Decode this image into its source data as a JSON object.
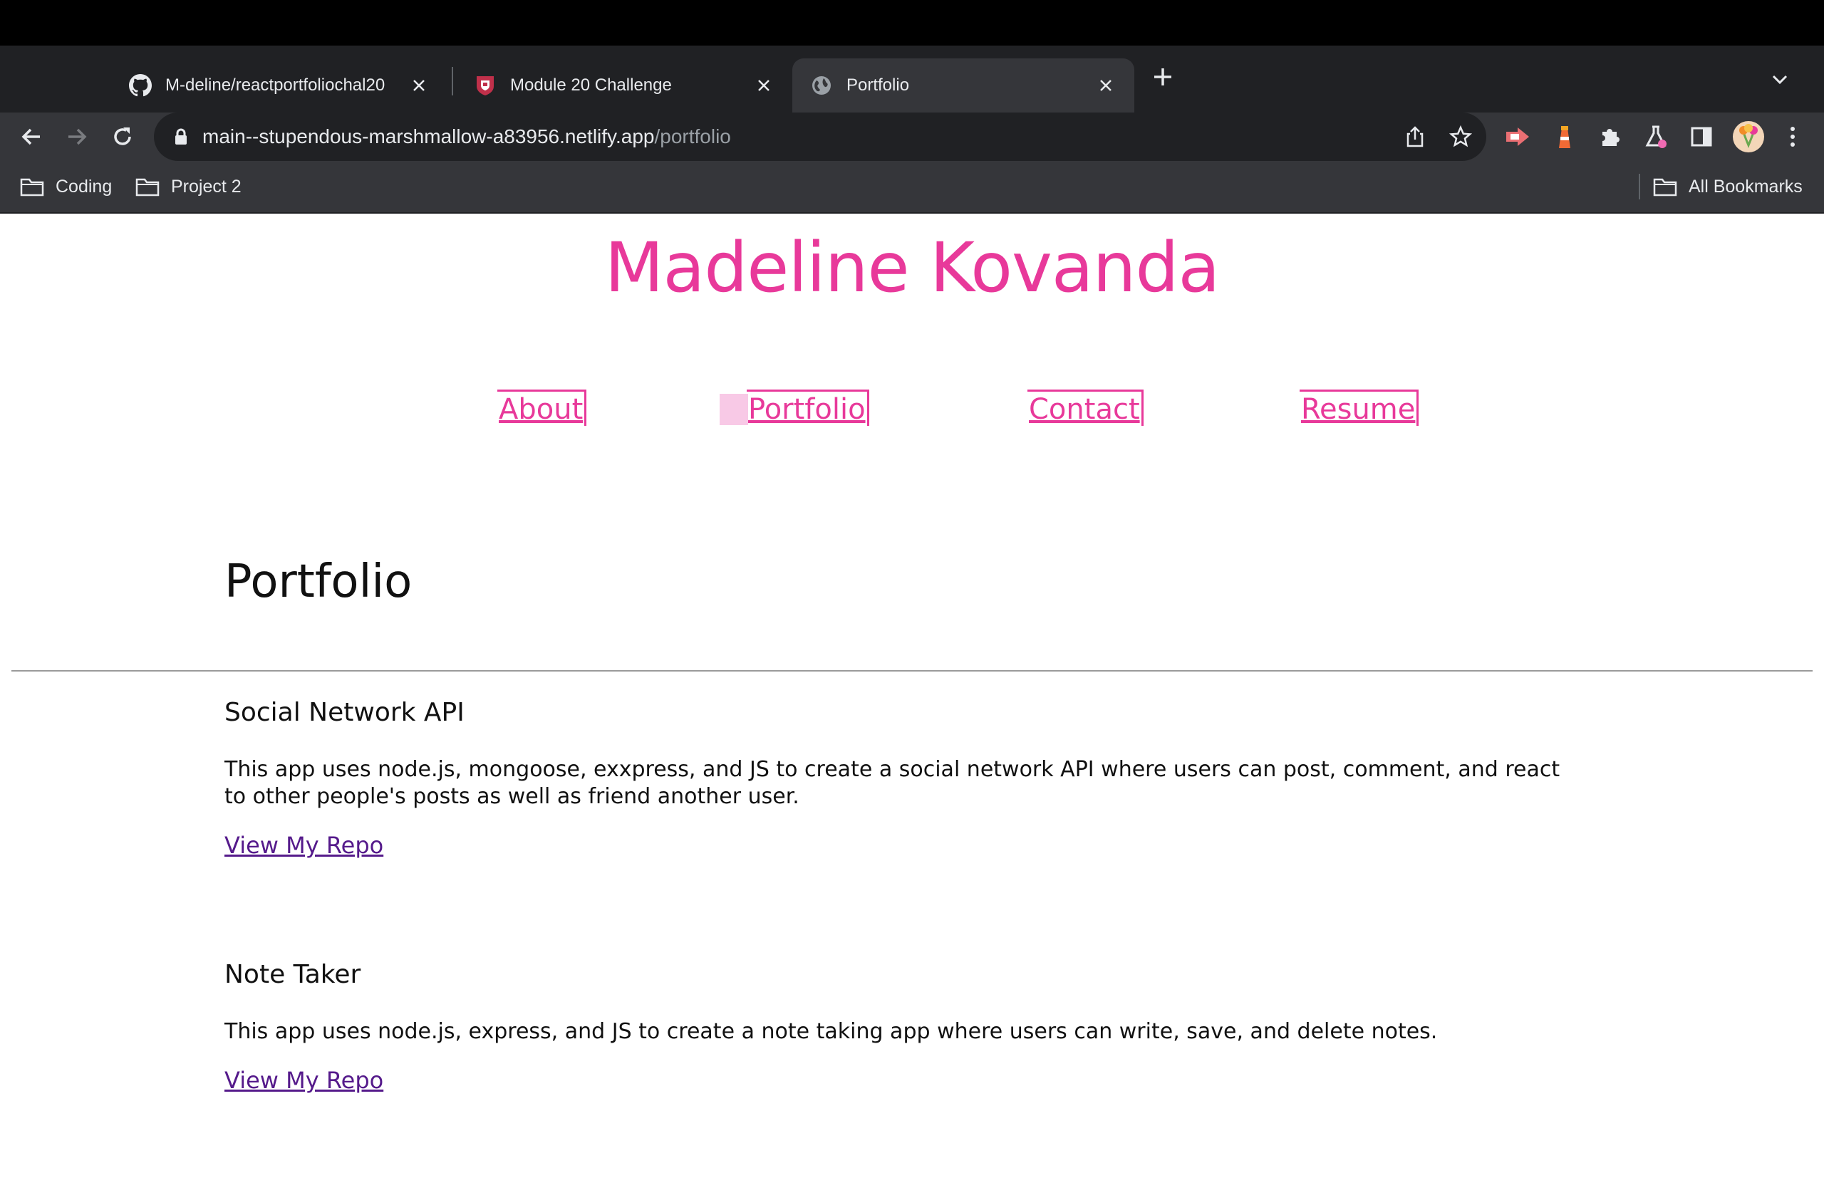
{
  "browser": {
    "tabs": [
      {
        "title": "M-deline/reactportfoliochal20",
        "icon": "github-icon",
        "active": false
      },
      {
        "title": "Module 20 Challenge",
        "icon": "shield-favicon",
        "active": false
      },
      {
        "title": "Portfolio",
        "icon": "globe-icon",
        "active": true
      }
    ],
    "url_host": "main--stupendous-marshmallow-a83956.netlify.app",
    "url_path": "/portfolio",
    "bookmarks": [
      {
        "label": "Coding",
        "icon": "folder-icon"
      },
      {
        "label": "Project 2",
        "icon": "folder-icon"
      }
    ],
    "all_bookmarks_label": "All Bookmarks"
  },
  "site": {
    "title": "Madeline Kovanda",
    "nav": [
      {
        "label": "About",
        "active": false
      },
      {
        "label": "Portfolio",
        "active": true
      },
      {
        "label": "Contact",
        "active": false
      },
      {
        "label": "Resume",
        "active": false
      }
    ],
    "accent_color": "#e8399a"
  },
  "portfolio": {
    "heading": "Portfolio",
    "projects": [
      {
        "title": "Social Network API",
        "description": "This app uses node.js, mongoose, exxpress, and JS to create a social network API where users can post, comment, and react to other people's posts as well as friend another user.",
        "link_label": "View My Repo"
      },
      {
        "title": "Note Taker",
        "description": "This app uses node.js, express, and JS to create a note taking app where users can write, save, and delete notes.",
        "link_label": "View My Repo"
      }
    ]
  }
}
